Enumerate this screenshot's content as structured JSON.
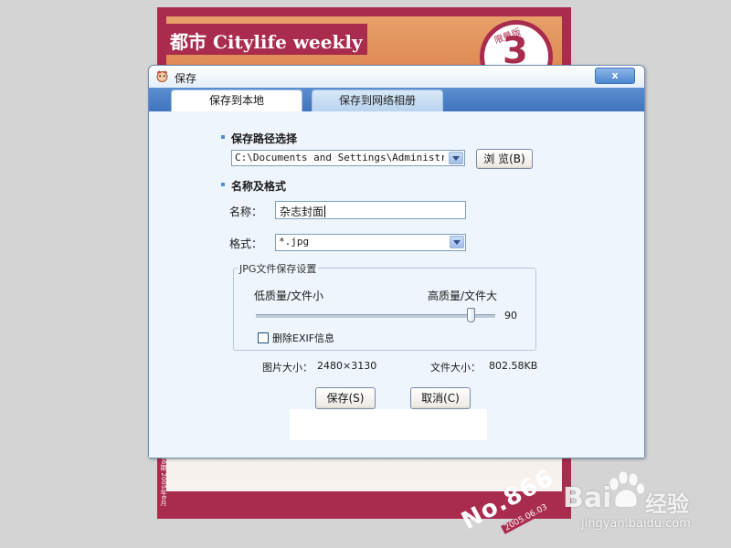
{
  "background": {
    "cover_title": "都市 Citylife weekly",
    "cover_badge_text": "限量版",
    "cover_badge_number": "3",
    "cover_issue": "No.866",
    "cover_issue_date": "2005.06.03",
    "cover_side_text": "ISSN 1672-2549 总第866期 2005年6月"
  },
  "dialog": {
    "title": "保存",
    "close_label": "x",
    "tabs": [
      {
        "label": "保存到本地",
        "active": true
      },
      {
        "label": "保存到网络相册",
        "active": false
      }
    ],
    "path_section": {
      "heading": "保存路径选择",
      "path_value": "C:\\Documents and Settings\\Administrator\\...",
      "browse_label": "浏 览(B)"
    },
    "name_section": {
      "heading": "名称及格式",
      "name_label": "名称：",
      "name_value": "杂志封面",
      "format_label": "格式：",
      "format_value": "*.jpg"
    },
    "jpg_settings": {
      "legend": "JPG文件保存设置",
      "low_label": "低质量/文件小",
      "high_label": "高质量/文件大",
      "quality_value": "90",
      "quality_fraction": 0.9,
      "exif_label": "删除EXIF信息",
      "exif_checked": false
    },
    "info": {
      "image_size_label": "图片大小：",
      "image_size_value": "2480×3130",
      "file_size_label": "文件大小：",
      "file_size_value": "802.58KB"
    },
    "buttons": {
      "save_label": "保存(S)",
      "cancel_label": "取消(C)"
    }
  },
  "watermark": {
    "brand": "Bai",
    "brand_cn": "经验",
    "url": "jingyan.baidu.com"
  },
  "colors": {
    "accent": "#4f8ed6",
    "tabstrip": "#3f75bd",
    "cover": "#a92b4e"
  }
}
